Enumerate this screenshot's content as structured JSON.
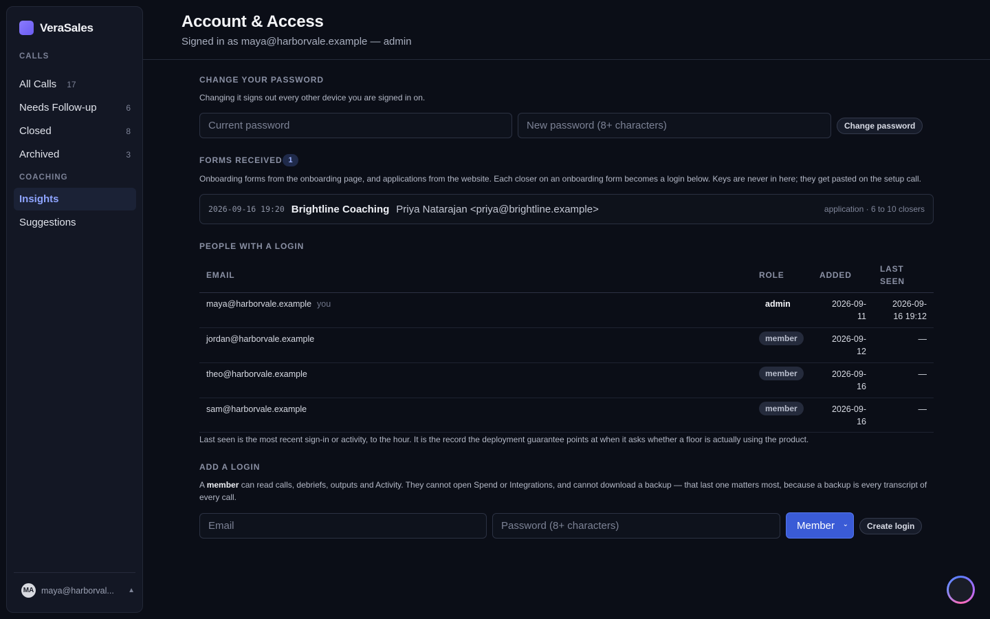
{
  "app": {
    "brand": "VeraSales"
  },
  "sidebar": {
    "calls_heading": "CALLS",
    "calls": [
      {
        "label": "All Calls",
        "count": "17"
      },
      {
        "label": "Needs Follow-up",
        "count": "6"
      },
      {
        "label": "Closed",
        "count": "8"
      },
      {
        "label": "Archived",
        "count": "3"
      }
    ],
    "coaching_heading": "COACHING",
    "coaching": [
      {
        "label": "Insights",
        "active": true
      },
      {
        "label": "Suggestions"
      }
    ],
    "user": {
      "initials": "MA",
      "email": "maya@harborval..."
    }
  },
  "header": {
    "title": "Account & Access",
    "subtitle": "Signed in as maya@harborvale.example — admin"
  },
  "password": {
    "heading": "CHANGE YOUR PASSWORD",
    "description": "Changing it signs out every other device you are signed in on.",
    "current_placeholder": "Current password",
    "new_placeholder": "New password (8+ characters)",
    "button": "Change password"
  },
  "forms": {
    "heading": "FORMS RECEIVED",
    "count": "1",
    "description": "Onboarding forms from the onboarding page, and applications from the website. Each closer on an onboarding form becomes a login below. Keys are never in here; they get pasted on the setup call.",
    "items": [
      {
        "time": "2026-09-16 19:20",
        "name": "Brightline Coaching",
        "contact": "Priya Natarajan <priya@brightline.example>",
        "meta": "application · 6 to 10 closers"
      }
    ]
  },
  "people": {
    "heading": "PEOPLE WITH A LOGIN",
    "columns": {
      "email": "EMAIL",
      "role": "ROLE",
      "added": "ADDED",
      "last_seen_1": "LAST",
      "last_seen_2": "SEEN"
    },
    "rows": [
      {
        "email": "maya@harborvale.example",
        "you": "you",
        "role": "admin",
        "added_1": "2026-09-",
        "added_2": "11",
        "seen_1": "2026-09-",
        "seen_2": "16 19:12"
      },
      {
        "email": "jordan@harborvale.example",
        "role": "member",
        "added_1": "2026-09-",
        "added_2": "12",
        "seen_1": "—"
      },
      {
        "email": "theo@harborvale.example",
        "role": "member",
        "added_1": "2026-09-",
        "added_2": "16",
        "seen_1": "—"
      },
      {
        "email": "sam@harborvale.example",
        "role": "member",
        "added_1": "2026-09-",
        "added_2": "16",
        "seen_1": "—"
      }
    ],
    "footnote": "Last seen is the most recent sign-in or activity, to the hour. It is the record the deployment guarantee points at when it asks whether a floor is actually using the product."
  },
  "add_login": {
    "heading": "ADD A LOGIN",
    "desc_prefix": "A ",
    "desc_bold": "member",
    "desc_rest": " can read calls, debriefs, outputs and Activity. They cannot open Spend or Integrations, and cannot download a backup — that last one matters most, because a backup is every transcript of every call.",
    "email_placeholder": "Email",
    "password_placeholder": "Password (8+ characters)",
    "role_value": "Member",
    "button": "Create login"
  }
}
